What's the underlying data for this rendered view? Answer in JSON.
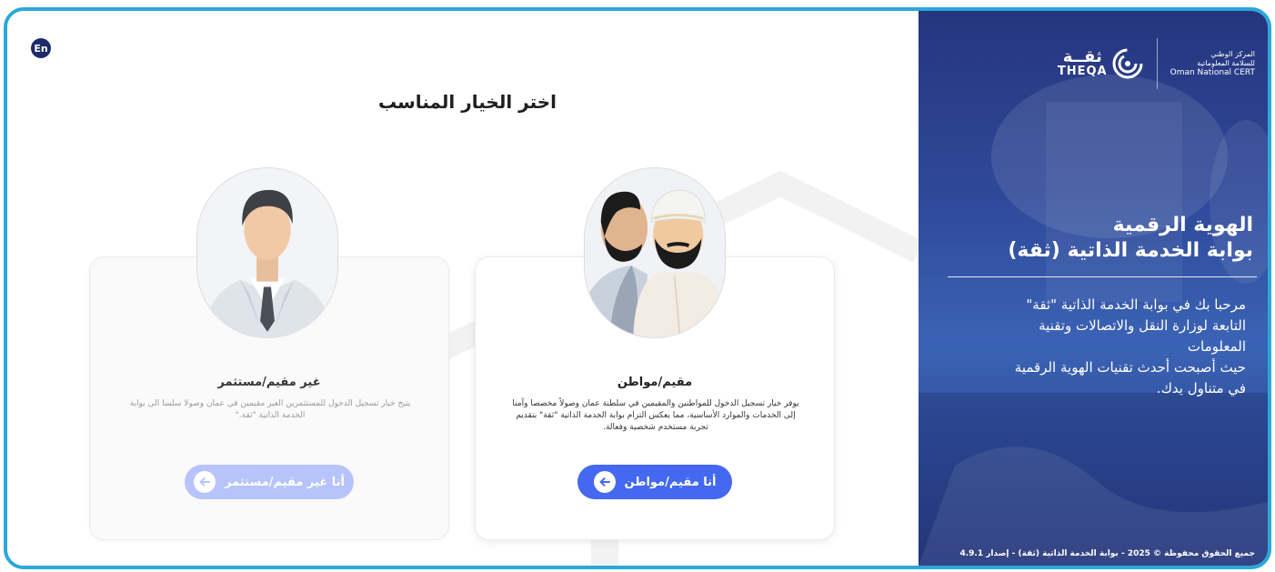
{
  "language_toggle": {
    "label": "En"
  },
  "main": {
    "title": "اختر الخيار المناسب",
    "cards": {
      "resident": {
        "title": "مقيم/مواطن",
        "description": "يوفر خيار تسجيل الدخول للمواطنين والمقيمين في سلطنة عمان وصولاً مخصصا وآمنا إلى الخدمات والموارد الأساسية، مما يعكس التزام بوابة الخدمة الذاتية \"ثقة\" بتقديم تجربة مستخدم شخصية وفعالة.",
        "button_label": "أنا مقيم/مواطن"
      },
      "non_resident": {
        "title": "غير مقيم/مستثمر",
        "description": "يتيح خيار تسجيل الدخول للمستثمرين الغير مقيمين في عمان وصولا سلسا الى بوابة الخدمة الذاتية \"ثقة.\"",
        "button_label": "أنا غير مقيم/مستثمر"
      }
    }
  },
  "sidebar": {
    "logo": {
      "theqa_ar": "ثقــة",
      "theqa_en": "THEQA",
      "cert_ar_line1": "المركز الوطني",
      "cert_ar_line2": "للسلامة المعلوماتية",
      "cert_en": "Oman National CERT"
    },
    "hero_title_line1": "الهوية الرقمية",
    "hero_title_line2": "بوابة الخدمة الذاتية (ثقة)",
    "hero_desc_line1": "مرحبا بك في بوابة الخدمة الذاتية \"ثقة\"",
    "hero_desc_line2": "التابعة لوزارة النقل والاتصالات وتقنية",
    "hero_desc_line3": "المعلومات",
    "hero_desc_line4": "حيث أصبحت أحدث تقنيات الهوية الرقمية",
    "hero_desc_line5": "في متناول يدك.",
    "copyright": "جميع الحقوق محفوظة © 2025 - بوابة الخدمة الذاتية (ثقة) - إصدار 4.9.1"
  },
  "colors": {
    "frame_border": "#29a8d9",
    "primary_button": "#4468f0",
    "disabled_button": "#b7c4fb",
    "sidebar_blue": "#2f4a9a"
  },
  "icons": [
    "arrow-left-icon",
    "theqa-logo-icon"
  ]
}
